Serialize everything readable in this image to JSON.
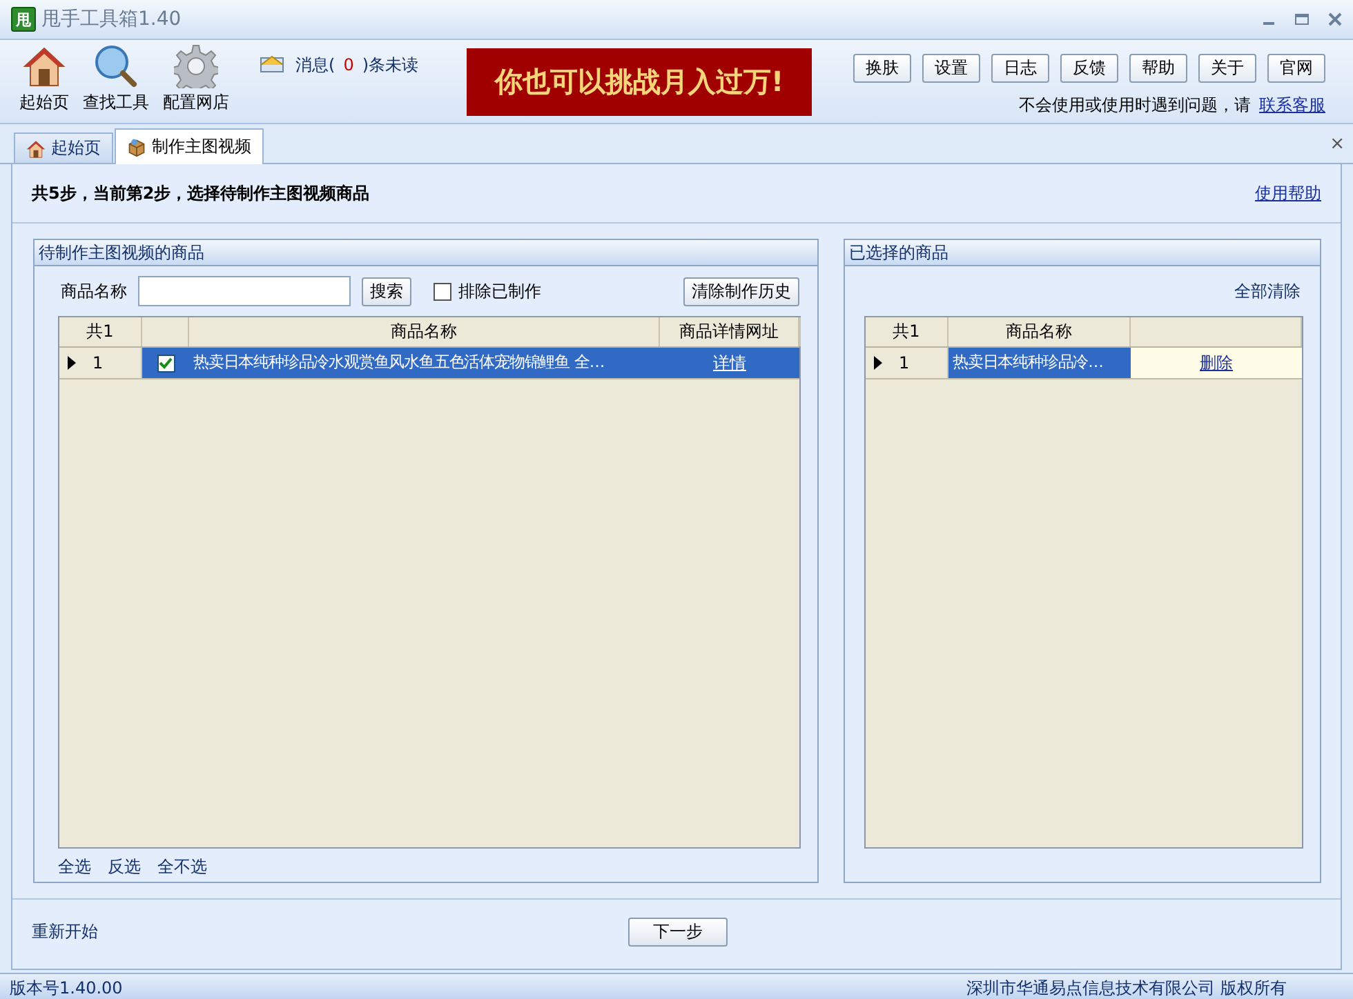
{
  "window": {
    "logo": "甩",
    "title": "甩手工具箱1.40"
  },
  "toolbar": {
    "tools": [
      {
        "label": "起始页",
        "kind": "house"
      },
      {
        "label": "查找工具",
        "kind": "search"
      },
      {
        "label": "配置网店",
        "kind": "gear"
      }
    ],
    "messages": {
      "prefix": "消息(",
      "count": "0",
      "suffix": ")条未读"
    },
    "banner": "你也可以挑战月入过万!",
    "buttons": [
      "换肤",
      "设置",
      "日志",
      "反馈",
      "帮助",
      "关于",
      "官网"
    ],
    "help_text": "不会使用或使用时遇到问题，请",
    "help_link": "联系客服"
  },
  "tabs": [
    {
      "label": "起始页",
      "kind": "house",
      "selected": false
    },
    {
      "label": "制作主图视频",
      "kind": "box",
      "selected": true
    }
  ],
  "tab_close": "×",
  "step": {
    "title": "共5步，当前第2步，选择待制作主图视频商品",
    "help_link": "使用帮助"
  },
  "left_panel": {
    "title": "待制作主图视频的商品",
    "search_label": "商品名称",
    "search_button": "搜索",
    "exclude": {
      "label": "排除已制作",
      "checked": false
    },
    "clear_button": "清除制作历史",
    "table": {
      "columns": [
        "共1",
        "商品名称",
        "商品详情网址"
      ],
      "rows": [
        {
          "index": "1",
          "checked": true,
          "name": "热卖日本纯种珍品冷水观赏鱼风水鱼五色活体宠物锦鲤鱼 全…",
          "link": "详情",
          "selected": true
        }
      ]
    },
    "select_links": [
      "全选",
      "反选",
      "全不选"
    ]
  },
  "right_panel": {
    "title": "已选择的商品",
    "clear_all": "全部清除",
    "table": {
      "columns": [
        "共1",
        "商品名称"
      ],
      "rows": [
        {
          "index": "1",
          "name": "热卖日本纯种珍品冷…",
          "action": "删除",
          "selected": true
        }
      ]
    }
  },
  "footer": {
    "restart": "重新开始",
    "next": "下一步"
  },
  "status_bar": {
    "version": "版本号1.40.00",
    "copyright": "深圳市华通易点信息技术有限公司  版权所有"
  }
}
